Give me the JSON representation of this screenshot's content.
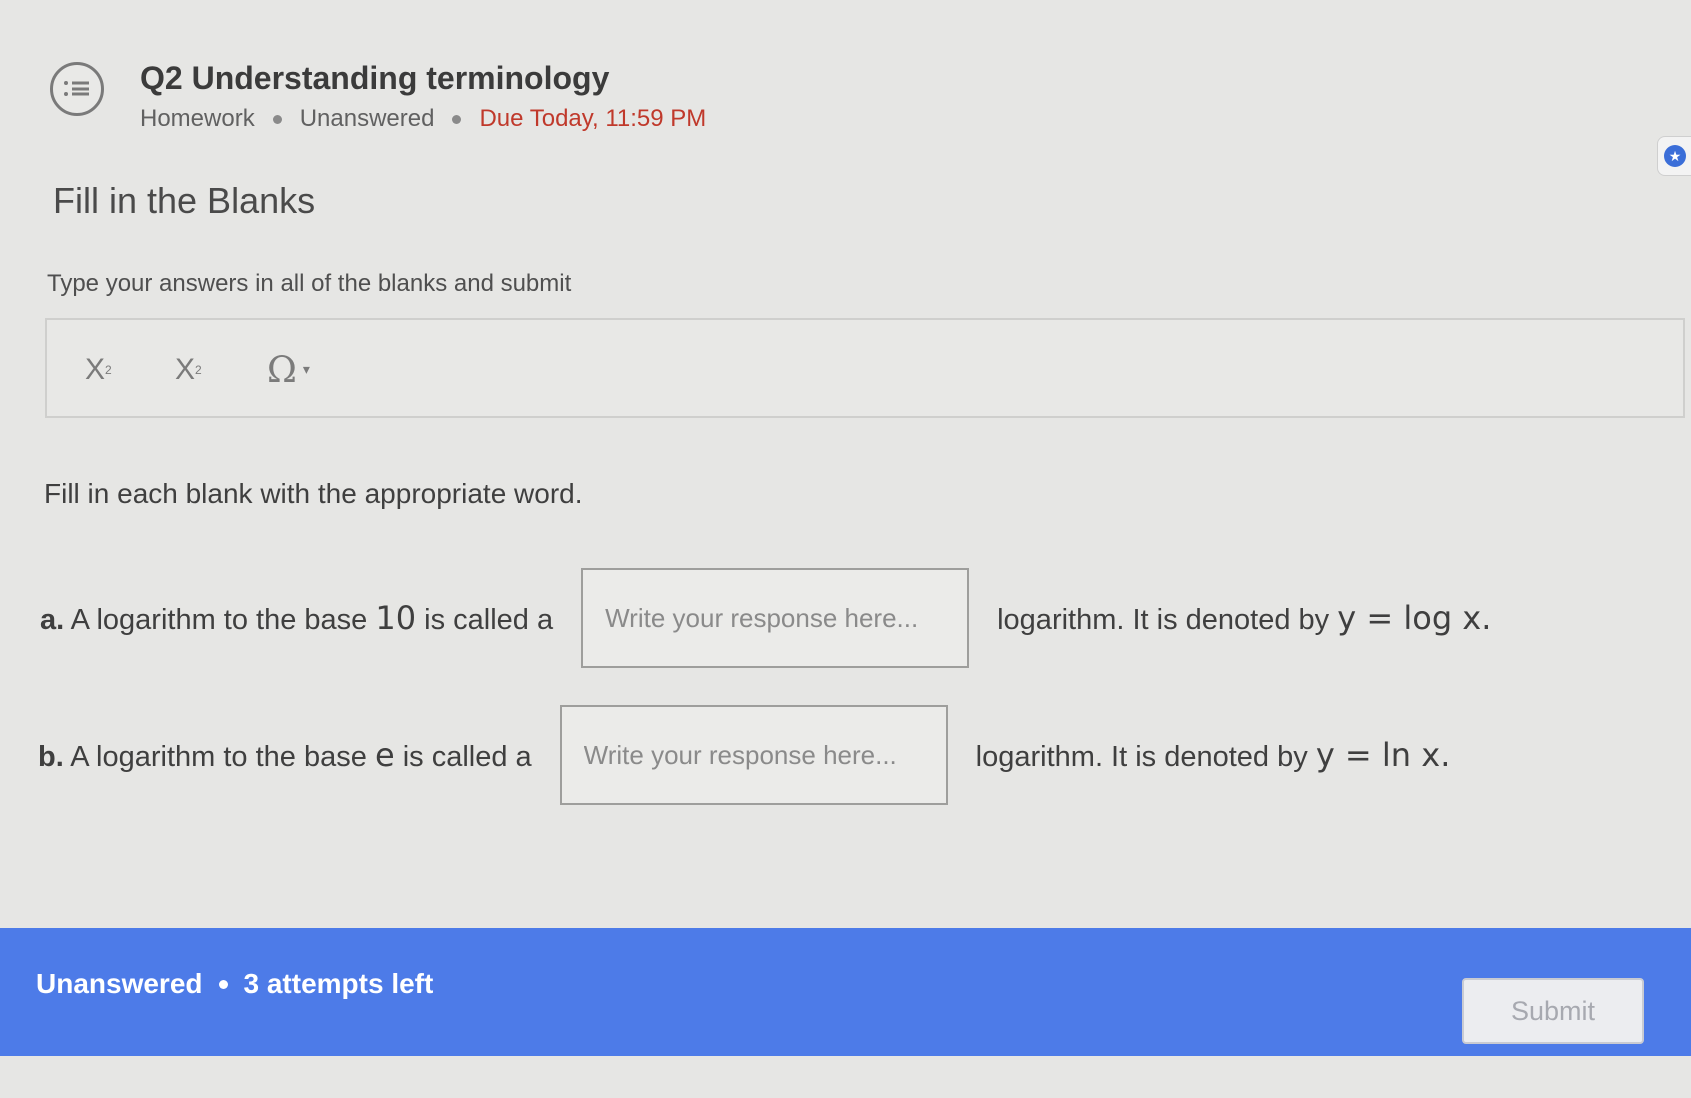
{
  "question": {
    "title": "Q2 Understanding terminology",
    "type": "Homework",
    "status": "Unanswered",
    "due": "Due Today, 11:59 PM"
  },
  "section": {
    "title": "Fill in the Blanks",
    "instructions": "Type your answers in all of the blanks and submit"
  },
  "toolbar": {
    "subscript_label": "X",
    "subscript_mark": "2",
    "superscript_label": "X",
    "superscript_mark": "2",
    "special_chars_label": "Ω",
    "special_chars_caret": "▾"
  },
  "prompt": "Fill in each blank with the appropriate word.",
  "items": [
    {
      "letter": "a.",
      "before": "A logarithm to the base",
      "base": "10",
      "mid": "is called a",
      "placeholder": "Write your response here...",
      "after": "logarithm. It is denoted by",
      "formula": "y = log x."
    },
    {
      "letter": "b.",
      "before": "A logarithm to the base",
      "base": "e",
      "mid": "is called a",
      "placeholder": "Write your response here...",
      "after": "logarithm. It is denoted by",
      "formula": "y = ln x."
    }
  ],
  "footer": {
    "status": "Unanswered",
    "attempts": "3 attempts left",
    "submit_label": "Submit"
  },
  "colors": {
    "accent": "#4d7be8",
    "due": "#c0392b"
  }
}
